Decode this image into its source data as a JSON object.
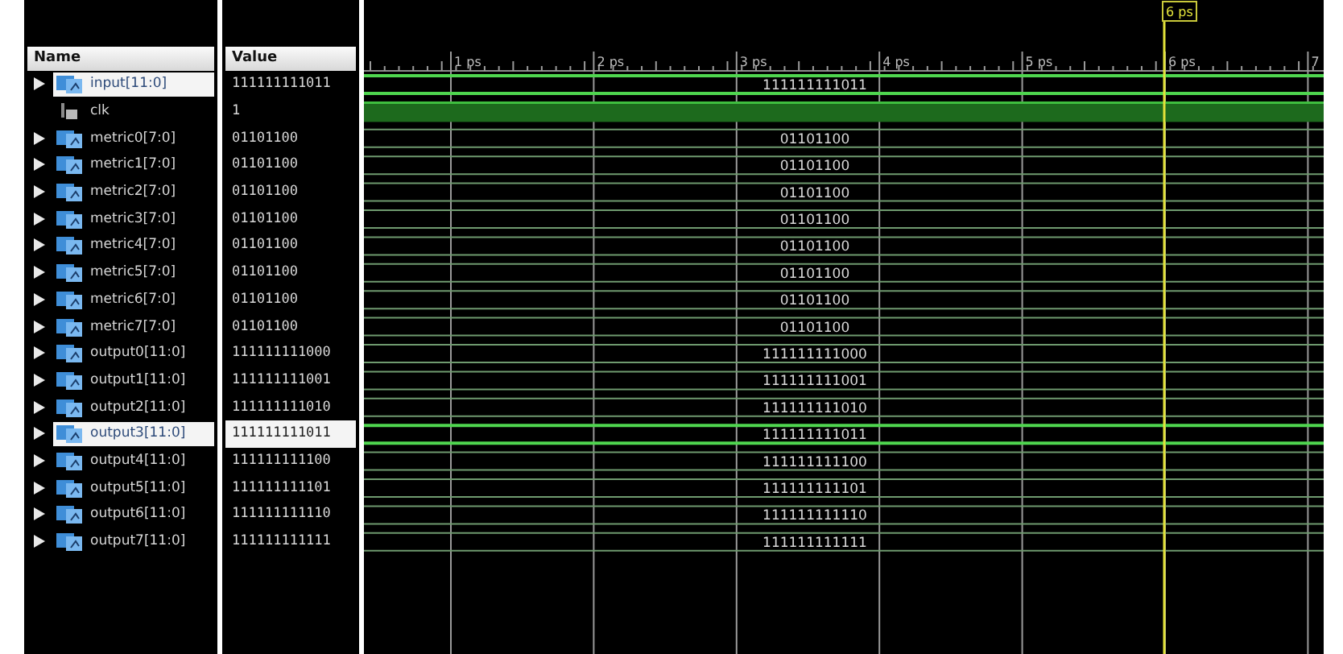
{
  "columns": {
    "name": "Name",
    "value": "Value"
  },
  "cursor": {
    "label": "6 ps"
  },
  "ruler": {
    "labels": [
      "1 ps",
      "2 ps",
      "3 ps",
      "4 ps",
      "5 ps",
      "6 ps",
      "7"
    ]
  },
  "signals": [
    {
      "name": "input[11:0]",
      "value": "111111111011",
      "kind": "bus",
      "expandable": true,
      "selected": true,
      "value_selected": false,
      "wave_label": "111111111011"
    },
    {
      "name": "clk",
      "value": "1",
      "kind": "bit",
      "expandable": false,
      "selected": false,
      "value_selected": false,
      "high": true
    },
    {
      "name": "metric0[7:0]",
      "value": "01101100",
      "kind": "bus",
      "expandable": true,
      "selected": false,
      "value_selected": false,
      "wave_label": "01101100"
    },
    {
      "name": "metric1[7:0]",
      "value": "01101100",
      "kind": "bus",
      "expandable": true,
      "selected": false,
      "value_selected": false,
      "wave_label": "01101100"
    },
    {
      "name": "metric2[7:0]",
      "value": "01101100",
      "kind": "bus",
      "expandable": true,
      "selected": false,
      "value_selected": false,
      "wave_label": "01101100"
    },
    {
      "name": "metric3[7:0]",
      "value": "01101100",
      "kind": "bus",
      "expandable": true,
      "selected": false,
      "value_selected": false,
      "wave_label": "01101100"
    },
    {
      "name": "metric4[7:0]",
      "value": "01101100",
      "kind": "bus",
      "expandable": true,
      "selected": false,
      "value_selected": false,
      "wave_label": "01101100"
    },
    {
      "name": "metric5[7:0]",
      "value": "01101100",
      "kind": "bus",
      "expandable": true,
      "selected": false,
      "value_selected": false,
      "wave_label": "01101100"
    },
    {
      "name": "metric6[7:0]",
      "value": "01101100",
      "kind": "bus",
      "expandable": true,
      "selected": false,
      "value_selected": false,
      "wave_label": "01101100"
    },
    {
      "name": "metric7[7:0]",
      "value": "01101100",
      "kind": "bus",
      "expandable": true,
      "selected": false,
      "value_selected": false,
      "wave_label": "01101100"
    },
    {
      "name": "output0[11:0]",
      "value": "111111111000",
      "kind": "bus",
      "expandable": true,
      "selected": false,
      "value_selected": false,
      "wave_label": "111111111000"
    },
    {
      "name": "output1[11:0]",
      "value": "111111111001",
      "kind": "bus",
      "expandable": true,
      "selected": false,
      "value_selected": false,
      "wave_label": "111111111001"
    },
    {
      "name": "output2[11:0]",
      "value": "111111111010",
      "kind": "bus",
      "expandable": true,
      "selected": false,
      "value_selected": false,
      "wave_label": "111111111010"
    },
    {
      "name": "output3[11:0]",
      "value": "111111111011",
      "kind": "bus",
      "expandable": true,
      "selected": true,
      "value_selected": true,
      "wave_label": "111111111011"
    },
    {
      "name": "output4[11:0]",
      "value": "111111111100",
      "kind": "bus",
      "expandable": true,
      "selected": false,
      "value_selected": false,
      "wave_label": "111111111100"
    },
    {
      "name": "output5[11:0]",
      "value": "111111111101",
      "kind": "bus",
      "expandable": true,
      "selected": false,
      "value_selected": false,
      "wave_label": "111111111101"
    },
    {
      "name": "output6[11:0]",
      "value": "111111111110",
      "kind": "bus",
      "expandable": true,
      "selected": false,
      "value_selected": false,
      "wave_label": "111111111110"
    },
    {
      "name": "output7[11:0]",
      "value": "111111111111",
      "kind": "bus",
      "expandable": true,
      "selected": false,
      "value_selected": false,
      "wave_label": "111111111111"
    }
  ]
}
